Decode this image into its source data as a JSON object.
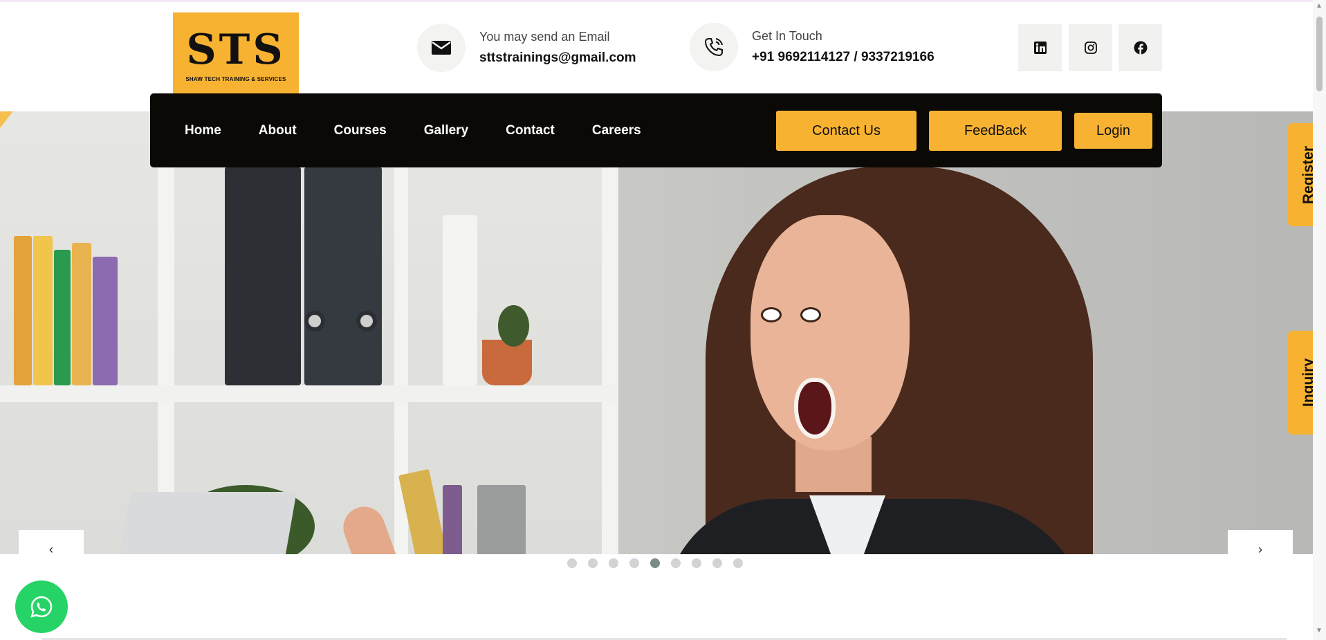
{
  "logo": {
    "mark": "STS",
    "subtitle": "SHAW TECH TRAINING & SERVICES"
  },
  "contact_info": {
    "email_label": "You may send an Email",
    "email_value": "sttstrainings@gmail.com",
    "phone_label": "Get In Touch",
    "phone_value": "+91 9692114127 / 9337219166"
  },
  "social": [
    "linkedin-icon",
    "instagram-icon",
    "facebook-icon"
  ],
  "nav": {
    "links": [
      "Home",
      "About",
      "Courses",
      "Gallery",
      "Contact",
      "Careers"
    ],
    "contact_button": "Contact Us",
    "feedback_button": "FeedBack",
    "login_button": "Login"
  },
  "side_tabs": {
    "register": "Register",
    "inquiry": "Inquiry"
  },
  "carousel": {
    "prev": "‹",
    "next": "›",
    "slide_count": 9,
    "active_slide": 5
  },
  "colors": {
    "accent": "#f8b232",
    "nav_bg": "#0b0906",
    "whatsapp": "#25d366"
  }
}
